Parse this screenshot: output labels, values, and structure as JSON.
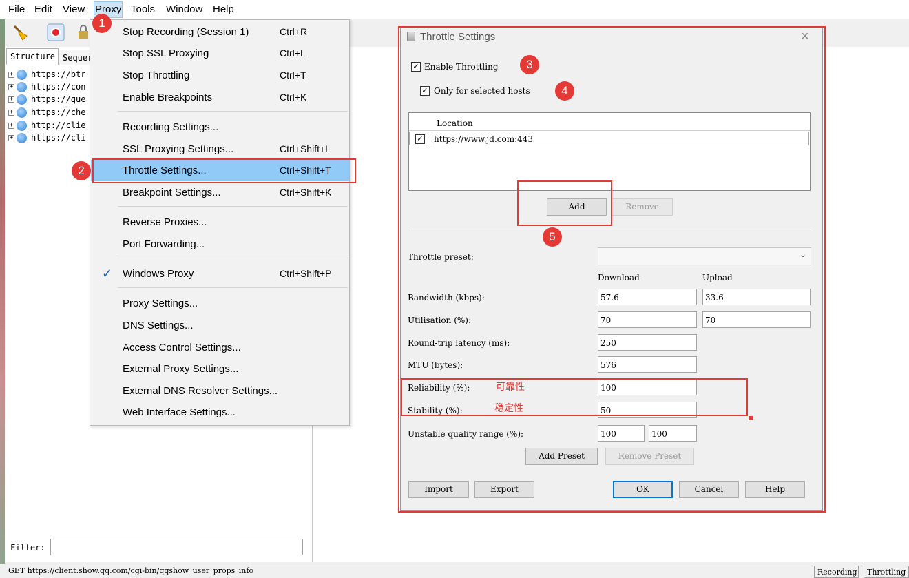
{
  "menubar": {
    "items": [
      "File",
      "Edit",
      "View",
      "Proxy",
      "Tools",
      "Window",
      "Help"
    ]
  },
  "toolbar": {
    "icons": [
      "broom-icon",
      "record-icon",
      "lock-icon"
    ]
  },
  "left_pane": {
    "tabs": [
      "Structure",
      "Sequer"
    ],
    "tree": [
      "https://btr",
      "https://con",
      "https://que",
      "https://che",
      "http://clie",
      "https://cli"
    ],
    "filter_label": "Filter:",
    "filter_value": ""
  },
  "proxy_menu": {
    "items": [
      {
        "label": "Stop Recording (Session 1)",
        "shortcut": "Ctrl+R"
      },
      {
        "label": "Stop SSL Proxying",
        "shortcut": "Ctrl+L"
      },
      {
        "label": "Stop Throttling",
        "shortcut": "Ctrl+T"
      },
      {
        "label": "Enable Breakpoints",
        "shortcut": "Ctrl+K"
      },
      {
        "label": "Recording Settings...",
        "shortcut": ""
      },
      {
        "label": "SSL Proxying Settings...",
        "shortcut": "Ctrl+Shift+L"
      },
      {
        "label": "Throttle Settings...",
        "shortcut": "Ctrl+Shift+T"
      },
      {
        "label": "Breakpoint Settings...",
        "shortcut": "Ctrl+Shift+K"
      },
      {
        "label": "Reverse Proxies...",
        "shortcut": ""
      },
      {
        "label": "Port Forwarding...",
        "shortcut": ""
      },
      {
        "label": "Windows Proxy",
        "shortcut": "Ctrl+Shift+P"
      },
      {
        "label": "Proxy Settings...",
        "shortcut": ""
      },
      {
        "label": "DNS Settings...",
        "shortcut": ""
      },
      {
        "label": "Access Control Settings...",
        "shortcut": ""
      },
      {
        "label": "External Proxy Settings...",
        "shortcut": ""
      },
      {
        "label": "External DNS Resolver Settings...",
        "shortcut": ""
      },
      {
        "label": "Web Interface Settings...",
        "shortcut": ""
      }
    ]
  },
  "dialog": {
    "title": "Throttle Settings",
    "enable_throttling": "Enable Throttling",
    "only_selected_hosts": "Only for selected hosts",
    "location_header": "Location",
    "location_row": "https://www.jd.com:443",
    "add": "Add",
    "remove": "Remove",
    "throttle_preset_label": "Throttle preset:",
    "preset_value": "",
    "download": "Download",
    "upload": "Upload",
    "bandwidth_label": "Bandwidth (kbps):",
    "bandwidth_down": "57.6",
    "bandwidth_up": "33.6",
    "utilisation_label": "Utilisation (%):",
    "utilisation_down": "70",
    "utilisation_up": "70",
    "latency_label": "Round-trip latency (ms):",
    "latency": "250",
    "mtu_label": "MTU (bytes):",
    "mtu": "576",
    "reliability_label": "Reliability (%):",
    "reliability": "100",
    "stability_label": "Stability (%):",
    "stability": "50",
    "unstable_label": "Unstable quality range (%):",
    "unstable_low": "100",
    "unstable_high": "100",
    "add_preset": "Add Preset",
    "remove_preset": "Remove Preset",
    "import": "Import",
    "export": "Export",
    "ok": "OK",
    "cancel": "Cancel",
    "help": "Help"
  },
  "annotations": {
    "badges": [
      "1",
      "2",
      "3",
      "4",
      "5"
    ],
    "reliability_note": "可靠性",
    "stability_note": "稳定性",
    "accent": "#e53935"
  },
  "status": {
    "text": "GET https://client.show.qq.com/cgi-bin/qqshow_user_props_info",
    "recording": "Recording",
    "throttling": "Throttling"
  }
}
